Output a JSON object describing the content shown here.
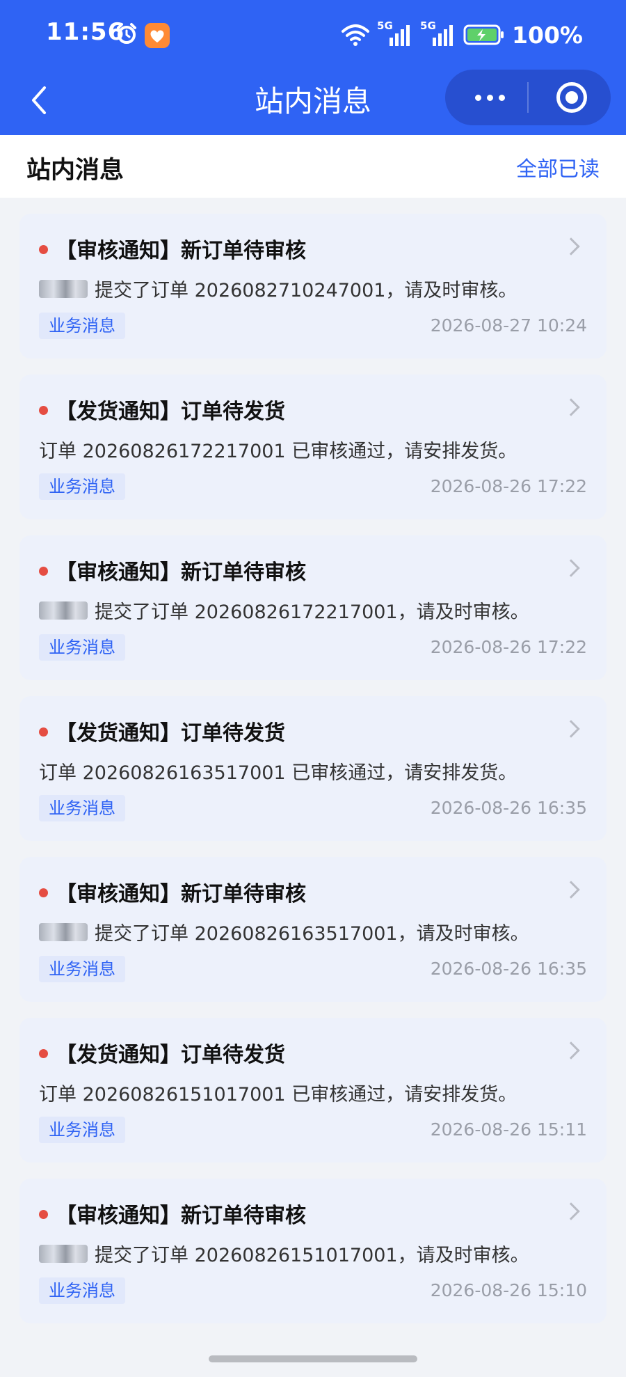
{
  "status_bar": {
    "time": "11:56",
    "signal1_label": "5G",
    "signal2_label": "5G",
    "battery_percent": "100%"
  },
  "nav": {
    "title": "站内消息"
  },
  "header": {
    "title": "站内消息",
    "mark_all_read": "全部已读"
  },
  "messages": [
    {
      "title": "【审核通知】新订单待审核",
      "has_redacted_name": true,
      "body": "提交了订单 2026082710247001，请及时审核。",
      "tag": "业务消息",
      "time": "2026-08-27 10:24"
    },
    {
      "title": "【发货通知】订单待发货",
      "has_redacted_name": false,
      "body": "订单 20260826172217001 已审核通过，请安排发货。",
      "tag": "业务消息",
      "time": "2026-08-26 17:22"
    },
    {
      "title": "【审核通知】新订单待审核",
      "has_redacted_name": true,
      "body": "提交了订单 20260826172217001，请及时审核。",
      "tag": "业务消息",
      "time": "2026-08-26 17:22"
    },
    {
      "title": "【发货通知】订单待发货",
      "has_redacted_name": false,
      "body": "订单 20260826163517001 已审核通过，请安排发货。",
      "tag": "业务消息",
      "time": "2026-08-26 16:35"
    },
    {
      "title": "【审核通知】新订单待审核",
      "has_redacted_name": true,
      "body": "提交了订单 20260826163517001，请及时审核。",
      "tag": "业务消息",
      "time": "2026-08-26 16:35"
    },
    {
      "title": "【发货通知】订单待发货",
      "has_redacted_name": false,
      "body": "订单 20260826151017001 已审核通过，请安排发货。",
      "tag": "业务消息",
      "time": "2026-08-26 15:11"
    },
    {
      "title": "【审核通知】新订单待审核",
      "has_redacted_name": true,
      "body": "提交了订单 20260826151017001，请及时审核。",
      "tag": "业务消息",
      "time": "2026-08-26 15:10"
    }
  ],
  "colors": {
    "primary": "#2f63f4",
    "unread_dot": "#e54d42",
    "card_bg": "#edf1fb",
    "page_bg": "#f1f3f7"
  }
}
